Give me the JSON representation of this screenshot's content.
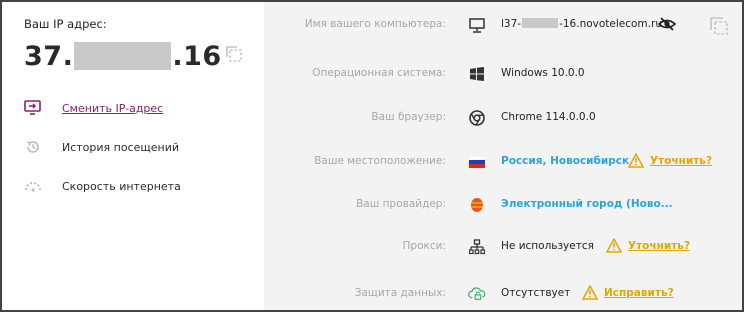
{
  "ip": {
    "label": "Ваш IP адрес:",
    "prefix": "37.",
    "suffix": ".16"
  },
  "menu": [
    {
      "label": "Сменить IP-адрес",
      "icon": "change-ip-icon"
    },
    {
      "label": "История посещений",
      "icon": "history-icon"
    },
    {
      "label": "Скорость интернета",
      "icon": "speedometer-icon"
    }
  ],
  "info": {
    "computer": {
      "label": "Имя вашего компьютера:",
      "value_prefix": "l37-",
      "value_suffix": "-16.novotelecom.ru"
    },
    "os": {
      "label": "Операционная система:",
      "value": "Windows 10.0.0"
    },
    "browser": {
      "label": "Ваш браузер:",
      "value": "Chrome 114.0.0.0"
    },
    "location": {
      "label": "Ваше местоположение:",
      "value": "Россия, Новосибирск",
      "action": "Уточнить?"
    },
    "provider": {
      "label": "Ваш провайдер:",
      "value": "Электронный город (Ново..."
    },
    "proxy": {
      "label": "Прокси:",
      "value": "Не используется",
      "action": "Уточнить?"
    },
    "protection": {
      "label": "Защита данных:",
      "value": "Отсутствует",
      "action": "Исправить?"
    }
  },
  "colors": {
    "accent": "#8b1e76",
    "link_blue": "#2aa5d8",
    "warning": "#e3a600",
    "label_gray": "#a7a7a7",
    "panel_bg": "#f3f3f3"
  }
}
